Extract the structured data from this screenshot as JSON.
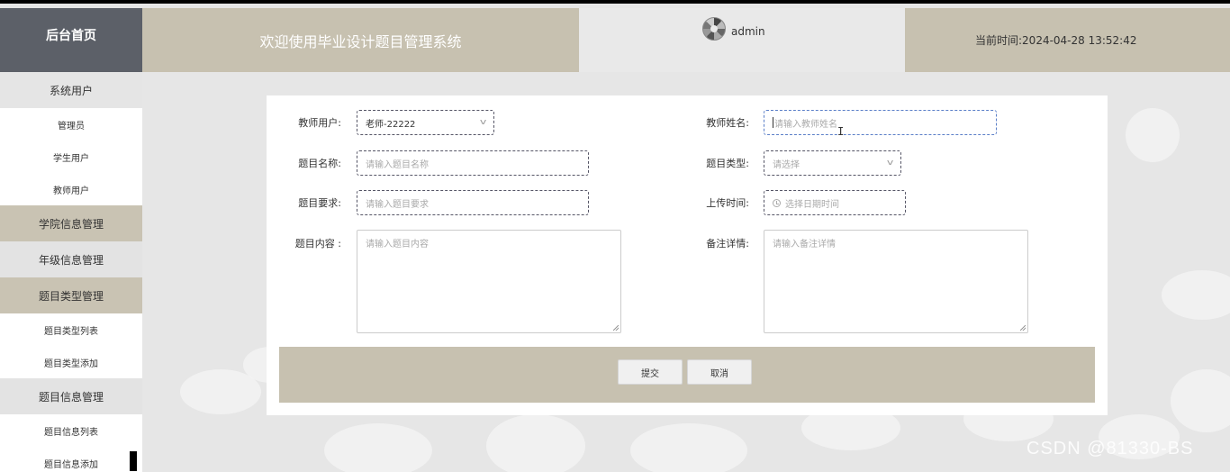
{
  "header": {
    "brand": "后台首页",
    "welcome": "欢迎使用毕业设计题目管理系统",
    "username": "admin",
    "time_label": "当前时间:",
    "time_value": "2024-04-28 13:52:42"
  },
  "sidebar": {
    "items": [
      {
        "label": "系统用户",
        "type": "group"
      },
      {
        "label": "管理员",
        "type": "sub"
      },
      {
        "label": "学生用户",
        "type": "sub"
      },
      {
        "label": "教师用户",
        "type": "sub"
      },
      {
        "label": "学院信息管理",
        "type": "group"
      },
      {
        "label": "年级信息管理",
        "type": "group"
      },
      {
        "label": "题目类型管理",
        "type": "group"
      },
      {
        "label": "题目类型列表",
        "type": "sub"
      },
      {
        "label": "题目类型添加",
        "type": "sub"
      },
      {
        "label": "题目信息管理",
        "type": "group"
      },
      {
        "label": "题目信息列表",
        "type": "sub"
      },
      {
        "label": "题目信息添加",
        "type": "sub"
      }
    ]
  },
  "form": {
    "teacher_user": {
      "label": "教师用户:",
      "value": "老师-22222"
    },
    "teacher_name": {
      "label": "教师姓名:",
      "placeholder": "请输入教师姓名"
    },
    "topic_name": {
      "label": "题目名称:",
      "placeholder": "请输入题目名称"
    },
    "topic_type": {
      "label": "题目类型:",
      "placeholder": "请选择"
    },
    "topic_req": {
      "label": "题目要求:",
      "placeholder": "请输入题目要求"
    },
    "upload_time": {
      "label": "上传时间:",
      "placeholder": "选择日期时间"
    },
    "topic_content": {
      "label": "题目内容 :",
      "placeholder": "请输入题目内容"
    },
    "remarks": {
      "label": "备注详情:",
      "placeholder": "请输入备注详情"
    },
    "submit_label": "提交",
    "cancel_label": "取消"
  },
  "watermark": "CSDN @81330-BS",
  "colors": {
    "accent": "#c7c1b0",
    "brand_bg": "#5c6068",
    "page_bg": "#e6e6e6"
  }
}
